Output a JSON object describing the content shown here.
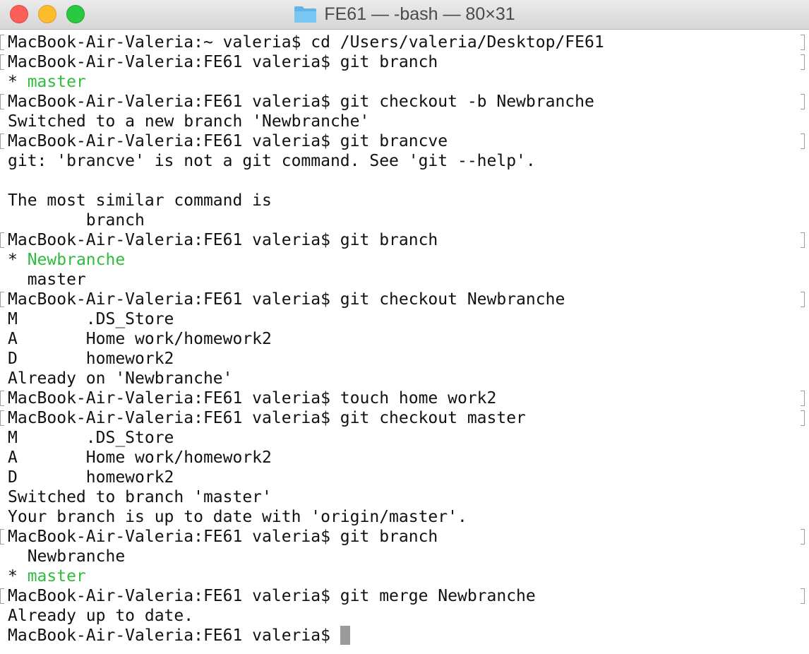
{
  "window": {
    "title": "FE61 — -bash — 80×31",
    "folder_icon": "folder-icon",
    "colors": {
      "close": "#fc5f57",
      "minimize": "#fdbc2e",
      "maximize": "#28c840",
      "prompt_text": "#111111",
      "branch_highlight": "#2fbc3c"
    }
  },
  "terminal": {
    "lines": [
      {
        "text": "MacBook-Air-Valeria:~ valeria$ cd /Users/valeria/Desktop/FE61",
        "kind": "prompt"
      },
      {
        "text": "MacBook-Air-Valeria:FE61 valeria$ git branch",
        "kind": "prompt"
      },
      {
        "prefix": "* ",
        "highlight": "master",
        "kind": "branch-current"
      },
      {
        "text": "MacBook-Air-Valeria:FE61 valeria$ git checkout -b Newbranche",
        "kind": "prompt"
      },
      {
        "text": "Switched to a new branch 'Newbranche'",
        "kind": "output"
      },
      {
        "text": "MacBook-Air-Valeria:FE61 valeria$ git brancve",
        "kind": "prompt"
      },
      {
        "text": "git: 'brancve' is not a git command. See 'git --help'.",
        "kind": "output"
      },
      {
        "text": "",
        "kind": "output"
      },
      {
        "text": "The most similar command is",
        "kind": "output"
      },
      {
        "text": "        branch",
        "kind": "output"
      },
      {
        "text": "MacBook-Air-Valeria:FE61 valeria$ git branch",
        "kind": "prompt"
      },
      {
        "prefix": "* ",
        "highlight": "Newbranche",
        "kind": "branch-current"
      },
      {
        "text": "  master",
        "kind": "output"
      },
      {
        "text": "MacBook-Air-Valeria:FE61 valeria$ git checkout Newbranche",
        "kind": "prompt"
      },
      {
        "text": "M       .DS_Store",
        "kind": "output"
      },
      {
        "text": "A       Home work/homework2",
        "kind": "output"
      },
      {
        "text": "D       homework2",
        "kind": "output"
      },
      {
        "text": "Already on 'Newbranche'",
        "kind": "output"
      },
      {
        "text": "MacBook-Air-Valeria:FE61 valeria$ touch home work2",
        "kind": "prompt"
      },
      {
        "text": "MacBook-Air-Valeria:FE61 valeria$ git checkout master",
        "kind": "prompt"
      },
      {
        "text": "M       .DS_Store",
        "kind": "output"
      },
      {
        "text": "A       Home work/homework2",
        "kind": "output"
      },
      {
        "text": "D       homework2",
        "kind": "output"
      },
      {
        "text": "Switched to branch 'master'",
        "kind": "output"
      },
      {
        "text": "Your branch is up to date with 'origin/master'.",
        "kind": "output"
      },
      {
        "text": "MacBook-Air-Valeria:FE61 valeria$ git branch",
        "kind": "prompt"
      },
      {
        "text": "  Newbranche",
        "kind": "output"
      },
      {
        "prefix": "* ",
        "highlight": "master",
        "kind": "branch-current"
      },
      {
        "text": "MacBook-Air-Valeria:FE61 valeria$ git merge Newbranche",
        "kind": "prompt"
      },
      {
        "text": "Already up to date.",
        "kind": "output"
      },
      {
        "text": "MacBook-Air-Valeria:FE61 valeria$ ",
        "kind": "active-prompt"
      }
    ]
  }
}
